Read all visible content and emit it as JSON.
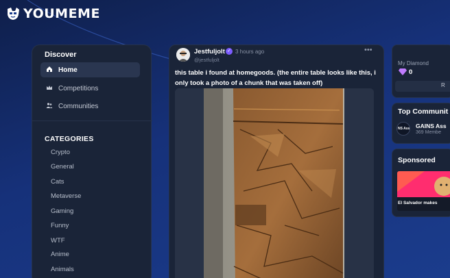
{
  "brand": {
    "name": "YOUMEME"
  },
  "sidebar": {
    "heading": "Discover",
    "nav": [
      {
        "label": "Home",
        "icon": "home-icon",
        "active": true
      },
      {
        "label": "Competitions",
        "icon": "crown-icon",
        "active": false
      },
      {
        "label": "Communities",
        "icon": "people-icon",
        "active": false
      }
    ],
    "categories_heading": "CATEGORIES",
    "categories": [
      "Crypto",
      "General",
      "Cats",
      "Metaverse",
      "Gaming",
      "Funny",
      "WTF",
      "Anime",
      "Animals"
    ]
  },
  "post": {
    "username": "Jestfuljolt",
    "handle": "@jestfuljolt",
    "time": "3 hours ago",
    "caption": "this table i found at homegoods. (the entire table looks like this, i only took a photo of a chunk that was taken off)",
    "more_icon": "more-horizontal-icon"
  },
  "right_rail": {
    "diamond": {
      "label": "My Diamond",
      "value": "0",
      "button_label": "R"
    },
    "top_communities": {
      "heading": "Top Communit",
      "item_name": "GAINS Ass",
      "item_sub": "369 Membe",
      "item_badge": "NS Ass"
    },
    "sponsored": {
      "heading": "Sponsored",
      "ad_caption": "El Salvador makes"
    }
  },
  "colors": {
    "background": "#16317a",
    "panel": "#1a2438",
    "accent": "#7c5cff",
    "diamond": "#c07cff"
  }
}
